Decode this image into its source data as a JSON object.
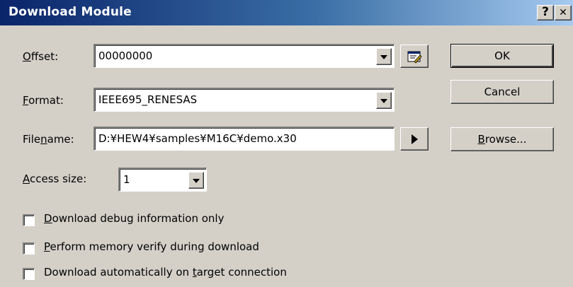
{
  "dialog": {
    "title": "Download Module",
    "help_button": "?",
    "close_button": "✕"
  },
  "offset": {
    "label_pre": "",
    "label_accel": "O",
    "label_post": "ffset:",
    "value": "00000000"
  },
  "format": {
    "label_pre": "",
    "label_accel": "F",
    "label_post": "ormat:",
    "value": "IEEE695_RENESAS"
  },
  "filename": {
    "label_pre": "File",
    "label_accel": "n",
    "label_post": "ame:",
    "value": "D:¥HEW4¥samples¥M16C¥demo.x30"
  },
  "access_size": {
    "label_pre": "",
    "label_accel": "A",
    "label_post": "ccess size:",
    "value": "1"
  },
  "buttons": {
    "ok": "OK",
    "cancel": "Cancel",
    "browse_accel": "B",
    "browse_rest": "rowse..."
  },
  "options": [
    {
      "pre": "",
      "accel": "D",
      "post": "ownload debug information only",
      "checked": false
    },
    {
      "pre": "",
      "accel": "P",
      "post": "erform memory verify during download",
      "checked": false
    },
    {
      "pre": "Download automatically on ",
      "accel": "t",
      "post": "arget connection",
      "checked": false
    }
  ]
}
